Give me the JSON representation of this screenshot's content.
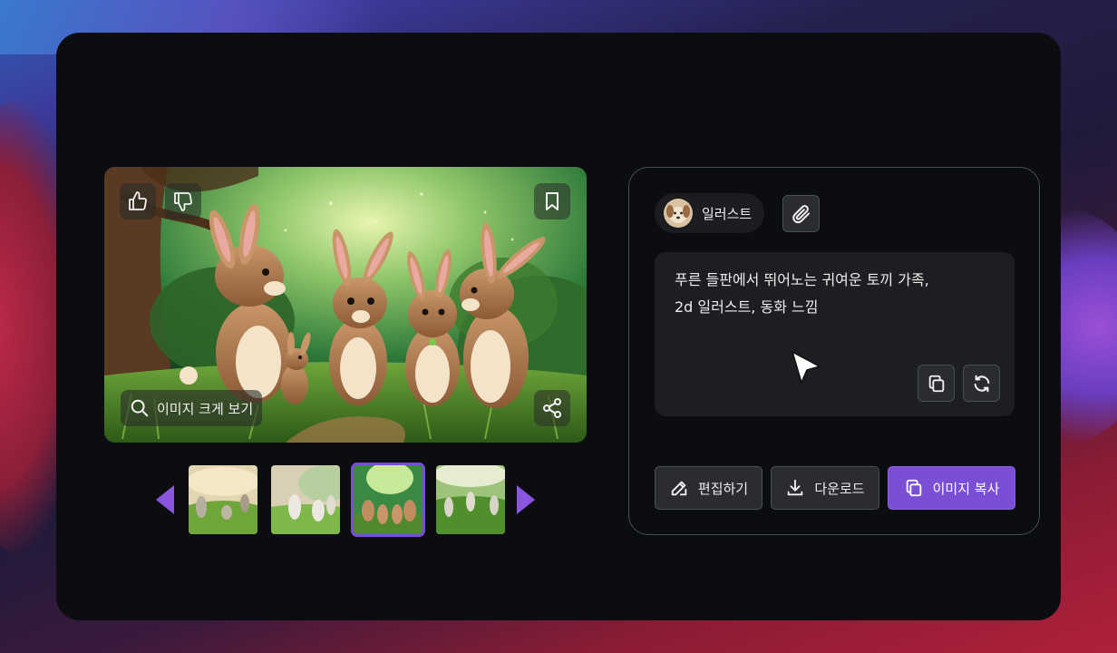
{
  "chip": {
    "label": "일러스트",
    "avatar_icon": "dog-avatar"
  },
  "image_controls": {
    "zoom_label": "이미지 크게 보기"
  },
  "prompt": {
    "text_line1": "푸른 들판에서 뛰어노는 귀여운 토끼 가족,",
    "text_line2": "2d 일러스트, 동화 느낌"
  },
  "actions": {
    "edit_label": "편집하기",
    "download_label": "다운로드",
    "copy_image_label": "이미지 복사"
  },
  "thumbnails": {
    "count": 4,
    "active_index": 2
  },
  "colors": {
    "accent": "#7a4fd4",
    "card_bg": "#0b0d10",
    "panel_border": "#4a4d52",
    "arrow": "#8b55e0"
  },
  "icons": [
    "thumbs-up-icon",
    "thumbs-down-icon",
    "bookmark-icon",
    "search-icon",
    "share-icon",
    "paperclip-icon",
    "copy-icon",
    "refresh-icon",
    "edit-icon",
    "download-icon",
    "image-copy-icon",
    "cursor-icon"
  ]
}
